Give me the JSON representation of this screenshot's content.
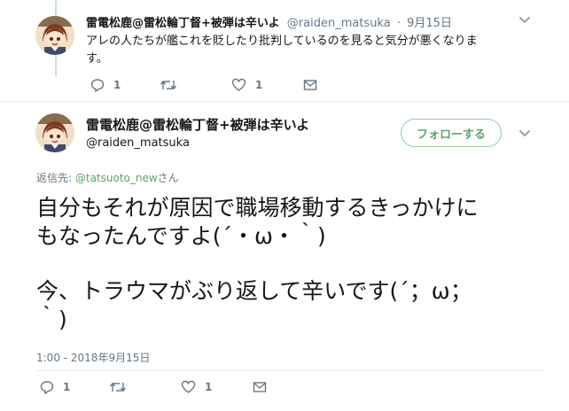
{
  "tweet1": {
    "display_name": "雷電松鹿@雷松輪丁督+被弾は辛いよ",
    "handle": "@raiden_matsuka",
    "separator": "·",
    "date": "9月15日",
    "text_line1": "アレの人たちが艦これを貶したり批判しているのを見ると気分が悪くなりま",
    "text_line2": "す。",
    "reply_count": "1",
    "retweet_count": "",
    "like_count": "1"
  },
  "tweet2": {
    "display_name": "雷電松鹿@雷松輪丁督+被弾は辛いよ",
    "handle": "@raiden_matsuka",
    "follow_label": "フォローする",
    "reply_prefix": "返信先: ",
    "reply_handle": "@tatsuoto_new",
    "reply_suffix": "さん",
    "text_line1": "自分もそれが原因で職場移動するきっかけに",
    "text_line2": "もなったんですよ(´・ω・｀)",
    "text_line3": "今、トラウマがぶり返して辛いです(´；ω；",
    "text_line4": "｀)",
    "timestamp": "1:00 - 2018年9月15日",
    "reply_count": "1",
    "retweet_count": "",
    "like_count": "1"
  },
  "colors": {
    "accent": "#5aa469",
    "thread_line": "#c4e3c4",
    "secondary_text": "#657786"
  },
  "icons": [
    "avatar",
    "chevron-down-icon",
    "reply-icon",
    "retweet-icon",
    "like-icon",
    "dm-icon"
  ]
}
